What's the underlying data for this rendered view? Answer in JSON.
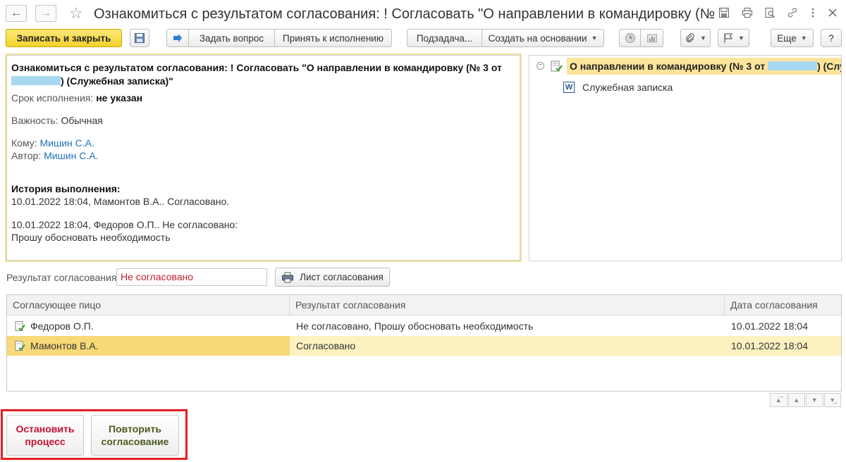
{
  "window": {
    "title": "Ознакомиться с результатом согласования: ! Согласовать \"О направлении в командировку (№..."
  },
  "toolbar": {
    "save_close": "Записать и закрыть",
    "ask_question": "Задать вопрос",
    "accept": "Принять к исполнению",
    "subtask": "Подзадача...",
    "create_based": "Создать на основании",
    "more": "Еще",
    "help": "?"
  },
  "task": {
    "title_line1": "Ознакомиться с результатом согласования: ! Согласовать \"О направлении в командировку (№ 3 от",
    "title_line2": ") (Служебная записка)\"",
    "deadline_label": "Срок исполнения:",
    "deadline_value": "не указан",
    "importance_label": "Важность:",
    "importance_value": "Обычная",
    "to_label": "Кому:",
    "to_value": "Мишин С.А.",
    "author_label": "Автор:",
    "author_value": "Мишин С.А.",
    "history_title": "История выполнения:",
    "history": [
      "10.01.2022 18:04, Мамонтов В.А.. Согласовано.",
      "10.01.2022 18:04, Федоров О.П.. Не согласовано:",
      "Прошу обосновать необходимость"
    ]
  },
  "tree": {
    "root_part1": "О направлении в командировку (№ 3 от",
    "root_part2": ") (Служ",
    "child": "Служебная записка"
  },
  "result": {
    "label": "Результат согласования:",
    "value": "Не согласовано",
    "sheet_button": "Лист согласования"
  },
  "table": {
    "columns": [
      "Согласующее пицо",
      "Результат согласования",
      "Дата согласования"
    ],
    "rows": [
      {
        "person": "Федоров О.П.",
        "result": "Не согласовано, Прошу обосновать необходимость",
        "date": "10.01.2022 18:04"
      },
      {
        "person": "Мамонтов В.А.",
        "result": "Согласовано",
        "date": "10.01.2022 18:04"
      }
    ]
  },
  "actions": {
    "stop_line1": "Остановить",
    "stop_line2": "процесс",
    "repeat_line1": "Повторить",
    "repeat_line2": "согласование"
  },
  "colors": {
    "stop": "#c8102e",
    "repeat": "#4a5a1e",
    "highlight": "#e31e24",
    "primary": "#f5d22c"
  }
}
